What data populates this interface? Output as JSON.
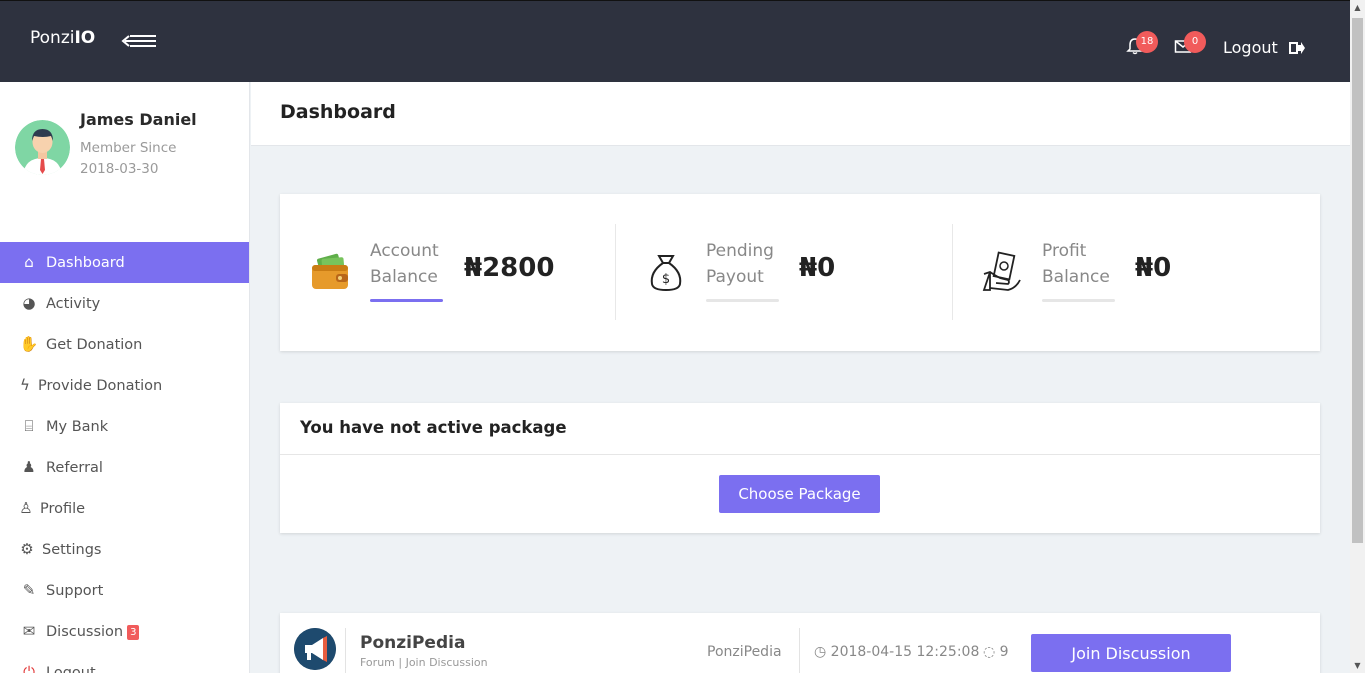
{
  "app": {
    "brand_prefix": "Ponzi",
    "brand_suffix": "IO"
  },
  "topbar": {
    "notifications_count": "18",
    "messages_count": "0",
    "logout_label": "Logout"
  },
  "user": {
    "name": "James Daniel",
    "member_since_label": "Member Since",
    "member_since_date": "2018-03-30"
  },
  "sidebar": {
    "items": [
      {
        "label": "Dashboard",
        "icon": "home-icon"
      },
      {
        "label": "Activity",
        "icon": "pie-chart-icon"
      },
      {
        "label": "Get Donation",
        "icon": "handshake-icon"
      },
      {
        "label": "Provide Donation",
        "icon": "bolt-icon"
      },
      {
        "label": "My Bank",
        "icon": "bank-icon"
      },
      {
        "label": "Referral",
        "icon": "users-icon"
      },
      {
        "label": "Profile",
        "icon": "user-icon"
      },
      {
        "label": "Settings",
        "icon": "gear-icon"
      },
      {
        "label": "Support",
        "icon": "ticket-icon"
      },
      {
        "label": "Discussion",
        "icon": "comments-icon",
        "badge": "3"
      },
      {
        "label": "Logout",
        "icon": "power-icon"
      }
    ]
  },
  "page": {
    "title": "Dashboard"
  },
  "stats": [
    {
      "label_line1": "Account",
      "label_line2": "Balance",
      "value": "₦2800",
      "icon": "wallet-icon"
    },
    {
      "label_line1": "Pending",
      "label_line2": "Payout",
      "value": "₦0",
      "icon": "money-bag-icon"
    },
    {
      "label_line1": "Profit",
      "label_line2": "Balance",
      "value": "₦0",
      "icon": "cash-hand-icon"
    }
  ],
  "package": {
    "heading": "You have not active package",
    "button_label": "Choose Package"
  },
  "forum": {
    "name": "PonziPedia",
    "sub_prefix": "Forum",
    "sub_sep": " | ",
    "sub_link": "Join Discussion",
    "category": "PonziPedia",
    "date": "2018-04-15 12:25:08",
    "comments": "9",
    "join_label": "Join Discussion"
  },
  "colors": {
    "accent": "#7b6ff0",
    "topbar": "#2e323f",
    "badge": "#f15b5b"
  }
}
